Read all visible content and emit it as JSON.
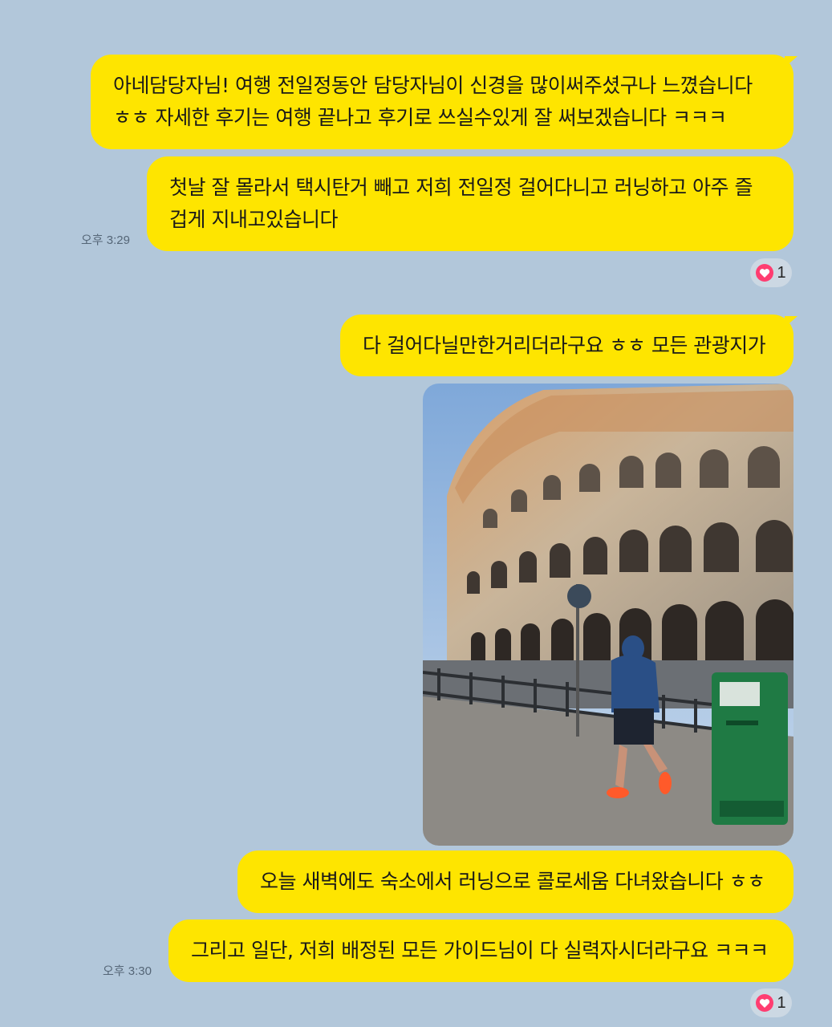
{
  "messages": [
    {
      "text": "아네담당자님! 여행 전일정동안 담당자님이 신경을 많이써주셨구나 느꼈습니다\nㅎㅎ 자세한 후기는 여행 끝나고 후기로 쓰실수있게 잘 써보겠습니다 ㅋㅋㅋ"
    },
    {
      "text": "첫날 잘 몰라서 택시탄거 빼고 저희 전일정 걸어다니고 러닝하고 아주 즐\n겁게 지내고있습니다",
      "time": "오후 3:29"
    },
    {
      "text": "다 걸어다닐만한거리더라구요 ㅎㅎ 모든 관광지가"
    },
    {
      "text": "오늘 새벽에도 숙소에서 러닝으로 콜로세움 다녀왔습니다 ㅎㅎ"
    },
    {
      "text": "그리고 일단, 저희 배정된 모든 가이드님이 다 실력자시더라구요 ㅋㅋㅋ",
      "time": "오후 3:30"
    }
  ],
  "reactions": [
    {
      "icon": "heart-icon",
      "count": "1"
    },
    {
      "icon": "heart-icon",
      "count": "1"
    }
  ],
  "photo": {
    "subject": "colosseum-photo"
  },
  "colors": {
    "background": "#b2c7da",
    "bubble": "#fee500",
    "heart": "#ff3d71"
  }
}
